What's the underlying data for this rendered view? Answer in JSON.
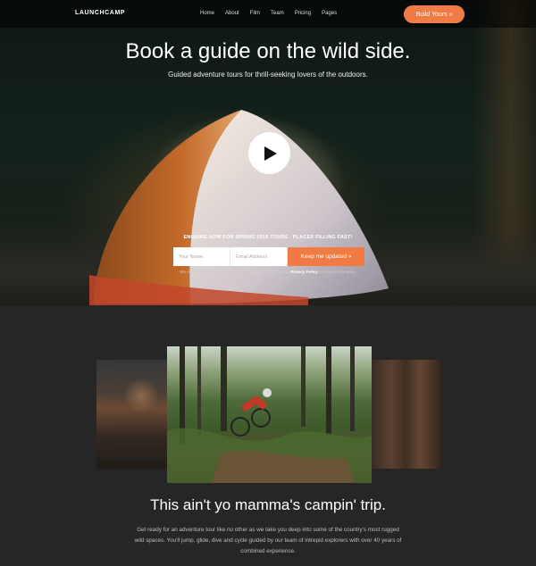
{
  "brand": {
    "logo": "LAUNCHCAMP"
  },
  "nav": {
    "items": [
      "Home",
      "About",
      "Film",
      "Team",
      "Pricing",
      "Pages"
    ],
    "cta": "Build Yours »"
  },
  "hero": {
    "title": "Book a guide on the wild side.",
    "subtitle": "Guided adventure tours for thrill-seeking lovers of the outdoors.",
    "play_icon": "play-icon",
    "enquire": "ENQUIRE NOW FOR SPRING 2015 TOURS - PLACES FILLING FAST!",
    "form": {
      "name_placeholder": "Your Name",
      "email_placeholder": "Email Address",
      "submit_label": "Keep me updated »"
    },
    "privacy_prefix": "We don't share your personal info with anyone. Check out our ",
    "privacy_link": "Privacy Policy",
    "privacy_suffix": " for more information."
  },
  "section": {
    "title": "This ain't yo mamma's campin' trip.",
    "body": "Get ready for an adventure tour like no other as we take you deep into some of the country's most rugged wild spaces. You'll jump, glide, dive and cycle guided by our team of intrepid explorers with over 40 years of combined experience."
  },
  "colors": {
    "accent": "#f07b45",
    "background": "#262626"
  }
}
